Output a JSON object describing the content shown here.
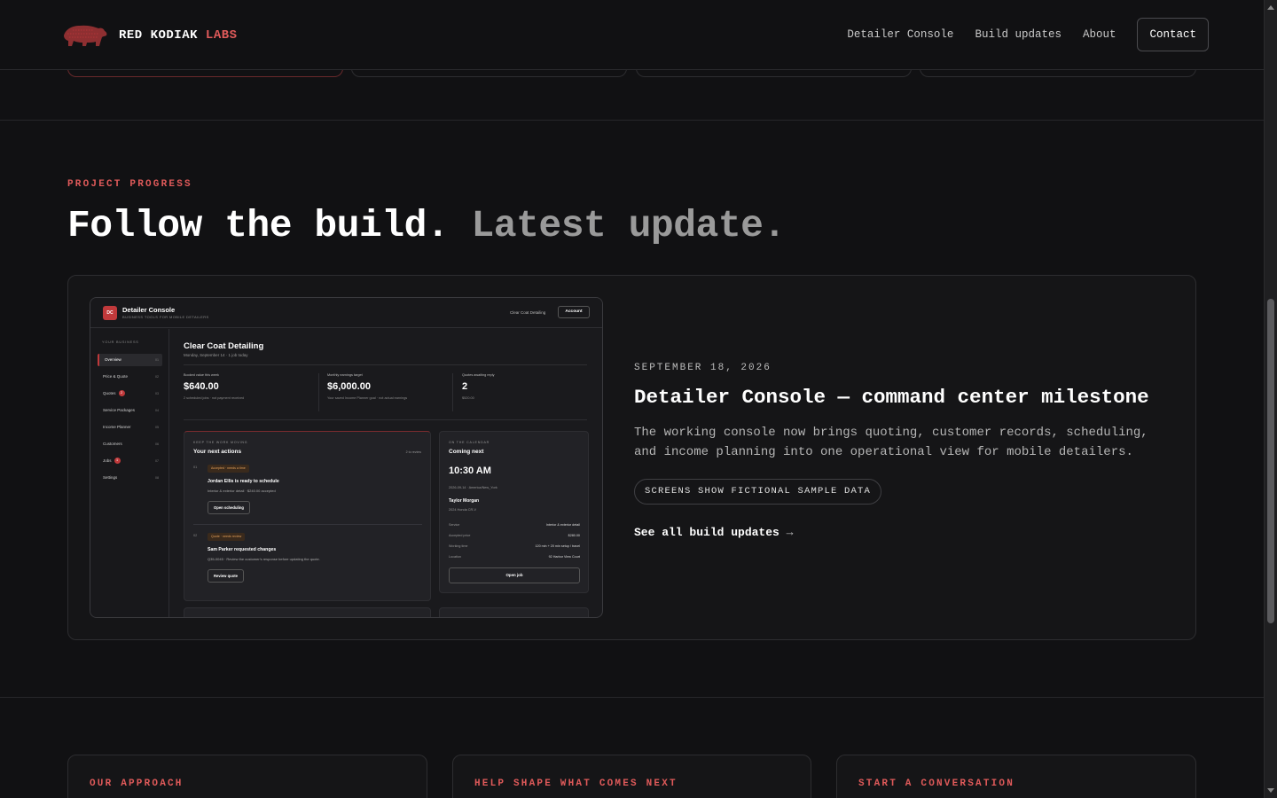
{
  "brand": {
    "name": "RED KODIAK",
    "accent": "LABS"
  },
  "nav": {
    "items": [
      "Detailer Console",
      "Build updates",
      "About"
    ],
    "contact": "Contact"
  },
  "progress": {
    "eyebrow": "PROJECT PROGRESS",
    "headline": "Follow the build.",
    "headline_muted": "Latest update."
  },
  "update": {
    "date": "SEPTEMBER 18, 2026",
    "title": "Detailer Console — command center milestone",
    "description": "The working console now brings quoting, customer records, scheduling, and income planning into one operational view for mobile detailers.",
    "pill": "SCREENS SHOW FICTIONAL SAMPLE DATA",
    "link": "See all build updates",
    "link_arrow": "→"
  },
  "screenshot": {
    "logo_initials": "DC",
    "app_name": "Detailer Console",
    "app_subtitle": "BUSINESS TOOLS FOR MOBILE DETAILERS",
    "business_name": "Clear Coat Detailing",
    "account_button": "Account",
    "sidebar_heading": "YOUR BUSINESS",
    "sidebar": [
      {
        "label": "Overview",
        "key": "01"
      },
      {
        "label": "Price & Quote",
        "key": "02"
      },
      {
        "label": "Quotes",
        "key": "03",
        "badge": "2"
      },
      {
        "label": "Service Packages",
        "key": "04"
      },
      {
        "label": "Income Planner",
        "key": "05"
      },
      {
        "label": "Customers",
        "key": "06"
      },
      {
        "label": "Jobs",
        "key": "07",
        "badge": "1"
      },
      {
        "label": "Settings",
        "key": "08"
      }
    ],
    "title": "Clear Coat Detailing",
    "date_line": "Monday, September 14 · 1 job today",
    "kpis": [
      {
        "label": "Booked value this week",
        "value": "$640.00",
        "note": "2 scheduled jobs · not payment received"
      },
      {
        "label": "Monthly earnings target",
        "value": "$6,000.00",
        "note": "Your saved Income Planner goal · not actual earnings"
      },
      {
        "label": "Quotes awaiting reply",
        "value": "2",
        "note": "$520.00"
      }
    ],
    "actions": {
      "eyebrow": "KEEP THE WORK MOVING",
      "title": "Your next actions",
      "count": "2 to review",
      "items": [
        {
          "num": "01",
          "tag": "Accepted · needs a time",
          "name": "Jordan Ellis is ready to schedule",
          "desc": "Interior & exterior detail · $240.00 accepted",
          "button": "Open scheduling"
        },
        {
          "num": "02",
          "tag": "Quote · needs review",
          "name": "Sam Parker requested changes",
          "desc": "Q35-0045 · Review the customer's response before updating the quote.",
          "button": "Review quote"
        }
      ]
    },
    "calendar": {
      "eyebrow": "ON THE CALENDAR",
      "title": "Coming next",
      "time": "10:30 AM",
      "tz": "2026-09-14 · America/New_York",
      "customer": "Taylor Morgan",
      "vehicle": "2024 Honda CR-V",
      "rows": [
        {
          "label": "Service",
          "value": "Interior & exterior detail"
        },
        {
          "label": "Accepted price",
          "value": "$280.00"
        },
        {
          "label": "Working time",
          "value": "120 min + 20 min setup / travel"
        },
        {
          "label": "Location",
          "value": "92 Harbor View Court"
        }
      ],
      "button": "Open job"
    }
  },
  "bottom_cards": [
    "OUR APPROACH",
    "HELP SHAPE WHAT COMES NEXT",
    "START A CONVERSATION"
  ],
  "colors": {
    "accent": "#e05a5a",
    "background": "#111113",
    "card": "#151517",
    "brand_red": "#c0393b"
  }
}
